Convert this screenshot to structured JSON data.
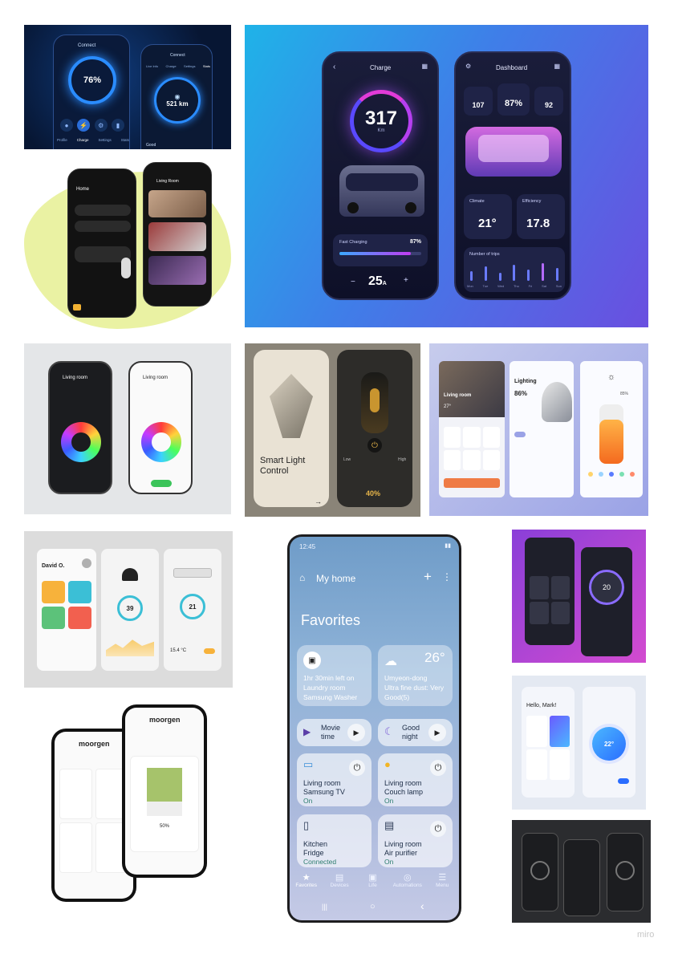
{
  "board": {
    "watermark": "miro"
  },
  "tile_ev1": {
    "left_phone": {
      "tab": "Connect",
      "percent": "76%",
      "nav": [
        "Profile",
        "Charge",
        "Settings",
        "Stats"
      ]
    },
    "right_phone": {
      "tab": "Connect",
      "tabs": [
        "Live Info",
        "Charge",
        "Settings",
        "Stats"
      ],
      "range": "521 km",
      "footer": "Good"
    }
  },
  "tile_home_dark": {
    "title": "Home",
    "room": "Living Room"
  },
  "tile_ev2": {
    "charge": {
      "title": "Charge",
      "value": "317",
      "unit": "Km",
      "fast_label": "Fast Charging",
      "fast_value": "87%",
      "amp": "25",
      "amp_unit": "A",
      "minus": "−",
      "plus": "+"
    },
    "dashboard": {
      "title": "Dashboard",
      "stats": [
        "107",
        "87%",
        "92"
      ],
      "climate_label": "Climate",
      "climate_value": "21°",
      "efficiency_label": "Efficiency",
      "efficiency_value": "17.8",
      "trips_label": "Number of trips",
      "days": [
        "Mon",
        "Tue",
        "Wed",
        "Thu",
        "Fri",
        "Sat",
        "Sun"
      ]
    }
  },
  "tile_colorwheel": {
    "room": "Living room"
  },
  "tile_smartlight": {
    "title": "Smart Light Control",
    "percent": "40%",
    "low": "Low",
    "high": "High"
  },
  "tile_lighting": {
    "room": "Living room",
    "temp": "27°",
    "lighting": "Lighting",
    "percent": "86%",
    "level": "85%"
  },
  "tile_david": {
    "name": "David O.",
    "value1": "39",
    "value2": "21",
    "temp": "15.4 °C"
  },
  "tile_moorgen": {
    "brand": "moorgen",
    "percent": "50%"
  },
  "main_phone": {
    "time": "12:45",
    "title": "My home",
    "add": "+",
    "more": "⋮",
    "favorites": "Favorites",
    "washer": {
      "line1": "1hr 30min left on",
      "line2": "Laundry room",
      "line3": "Samsung Washer"
    },
    "weather": {
      "temp": "26°",
      "line1": "Umyeon-dong",
      "line2": "Ultra fine dust: Very",
      "line3": "Good(5)"
    },
    "movie": {
      "line1": "Movie",
      "line2": "time"
    },
    "night": {
      "line1": "Good",
      "line2": "night"
    },
    "tv": {
      "line1": "Living room",
      "line2": "Samsung TV",
      "status": "On"
    },
    "lamp": {
      "line1": "Living room",
      "line2": "Couch lamp",
      "status": "On"
    },
    "fridge": {
      "line1": "Kitchen",
      "line2": "Fridge",
      "status": "Connected"
    },
    "purifier": {
      "line1": "Living room",
      "line2": "Air purifier",
      "status": "On"
    },
    "nav": [
      "Favorites",
      "Devices",
      "Life",
      "Automations",
      "Menu"
    ],
    "sysnav": {
      "recent": "|||",
      "home": "○",
      "back": "‹"
    }
  },
  "tile_purple": {
    "value": "20"
  },
  "tile_mark": {
    "greeting": "Hello, Mark!",
    "temp": "22°"
  }
}
